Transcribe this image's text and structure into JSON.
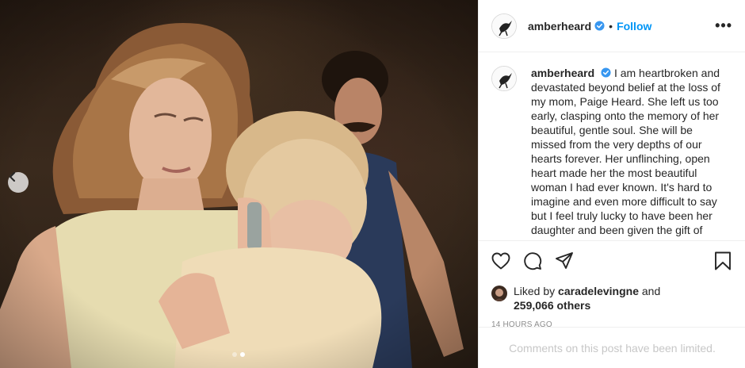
{
  "post": {
    "username": "amberheard",
    "follow_label": "Follow",
    "bullet": "•",
    "more_label": "•••"
  },
  "caption": {
    "username": "amberheard",
    "text": "I am heartbroken and devastated beyond belief at the loss of my mom, Paige Heard. She left us too early, clasping onto the memory of her beautiful, gentle soul. She will be missed from the very depths of our hearts forever. Her unflinching, open heart made her the most beautiful woman I had ever known. It's hard to imagine and even more difficult to say but I feel truly lucky to have been her daughter and been given the gift of"
  },
  "likes": {
    "prefix": "Liked by",
    "liker": "caradelevingne",
    "and": "and",
    "count": "259,066 others"
  },
  "timestamp": "14 HOURS AGO",
  "comments_limited": "Comments on this post have been limited.",
  "carousel": {
    "current": 2,
    "total": 2
  },
  "colors": {
    "link": "#0095f6",
    "verified": "#3897f0",
    "muted": "#8e8e8e"
  },
  "icons": [
    "ellipsis-icon",
    "verified-badge-icon",
    "heart-icon",
    "comment-icon",
    "share-icon",
    "bookmark-icon",
    "chevron-left-icon"
  ]
}
